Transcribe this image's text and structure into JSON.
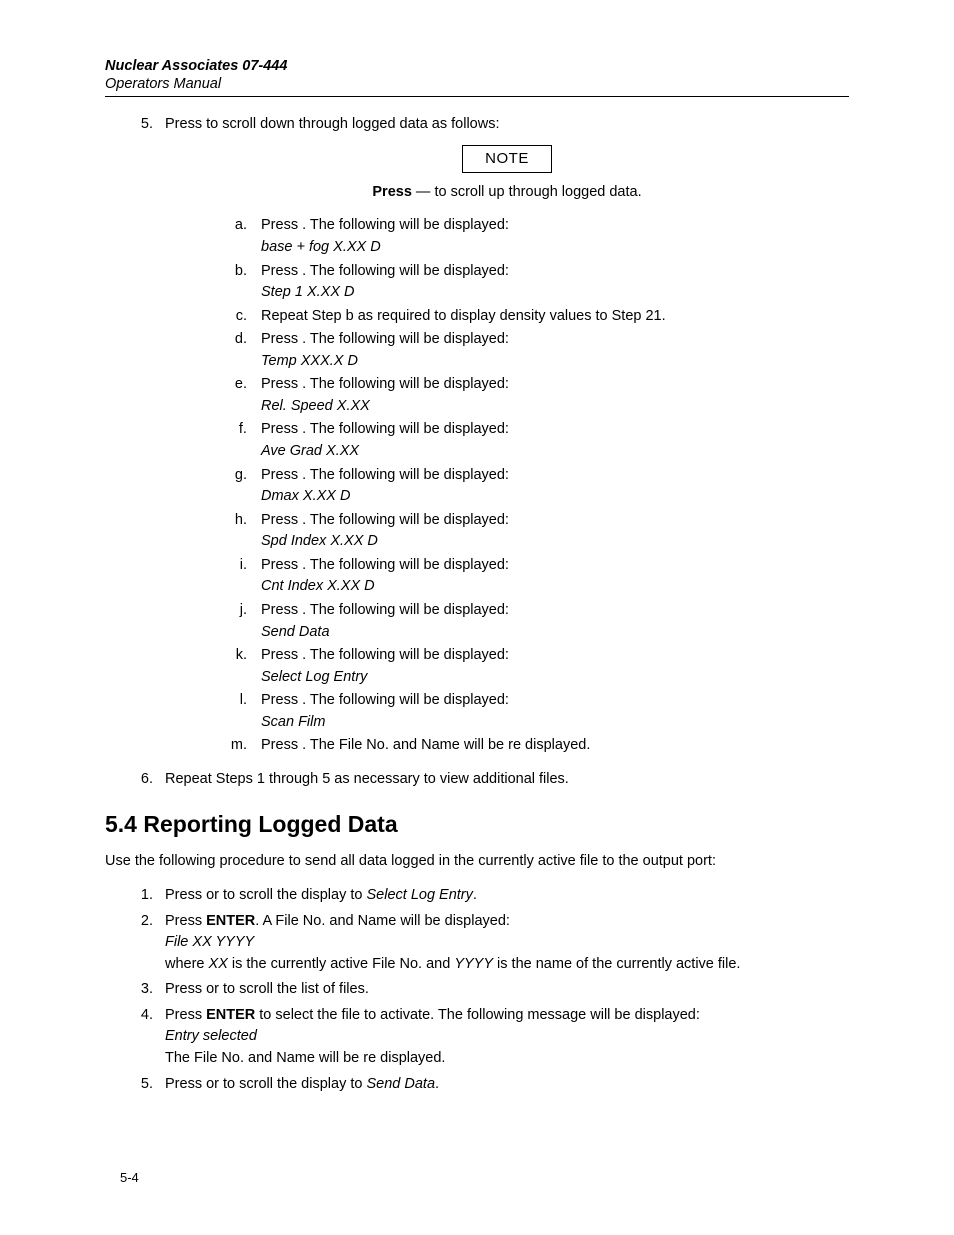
{
  "header": {
    "title": "Nuclear Associates 07-444",
    "subtitle": "Operators Manual"
  },
  "step5": {
    "num": "5.",
    "text": "Press   to scroll down through logged data as follows:"
  },
  "note": {
    "label": "NOTE",
    "bold": "Press",
    "rest": " — to scroll up through logged data."
  },
  "sub": {
    "a": {
      "t": "Press  . The following will be displayed:",
      "d": "base + fog  X.XX D"
    },
    "b": {
      "t": "Press  . The following will be displayed:",
      "d": "Step 1    X.XX D"
    },
    "c": {
      "t": "Repeat Step b as required to display density values to Step 21."
    },
    "d": {
      "t": "Press  . The following will be displayed:",
      "d": "Temp   XXX.X D"
    },
    "e": {
      "t": "Press  . The following will be displayed:",
      "d": "Rel. Speed X.XX"
    },
    "f": {
      "t": "Press  . The following will be displayed:",
      "d": "Ave Grad  X.XX"
    },
    "g": {
      "t": "Press  . The following will be displayed:",
      "d": "Dmax X.XX D"
    },
    "h": {
      "t": "Press  . The following will be displayed:",
      "d": "Spd Index X.XX D"
    },
    "i": {
      "t": "Press  . The following will be displayed:",
      "d": "Cnt Index X.XX D"
    },
    "j": {
      "t": "Press  . The following will be displayed:",
      "d": "Send Data"
    },
    "k": {
      "t": "Press  .  The following will be displayed:",
      "d": "Select Log Entry"
    },
    "l": {
      "t": "Press  .  The following will be displayed:",
      "d": "Scan Film"
    },
    "m": {
      "t": "Press  .  The File No. and Name will be re displayed."
    }
  },
  "step6": {
    "text": "Repeat Steps 1 through 5 as necessary to view additional files."
  },
  "section54": {
    "heading": "5.4 Reporting Logged Data",
    "intro": "Use the following procedure to send all data logged in the currently active file to the output port:"
  },
  "r": {
    "s1": {
      "pre": "Press   or   to scroll the display to ",
      "ital": "Select Log Entry",
      "post": "."
    },
    "s2": {
      "pre": "Press ",
      "bold": "ENTER",
      "post": ".  A File No. and Name will be displayed:",
      "disp": "File XX  YYYY",
      "where_pre": "where ",
      "xx": "XX",
      "mid": " is the currently active File No. and ",
      "yy": "YYYY",
      "where_post": " is the name of the currently active file."
    },
    "s3": {
      "t": "Press   or   to scroll the list of files."
    },
    "s4": {
      "pre": "Press ",
      "bold": "ENTER",
      "post": " to select the file to activate.  The following message will be displayed:",
      "disp": "Entry selected",
      "after": "The File No. and Name will be re displayed."
    },
    "s5": {
      "pre": "Press   or   to scroll the display to ",
      "ital": "Send Data",
      "post": "."
    }
  },
  "pagenum": "5-4"
}
